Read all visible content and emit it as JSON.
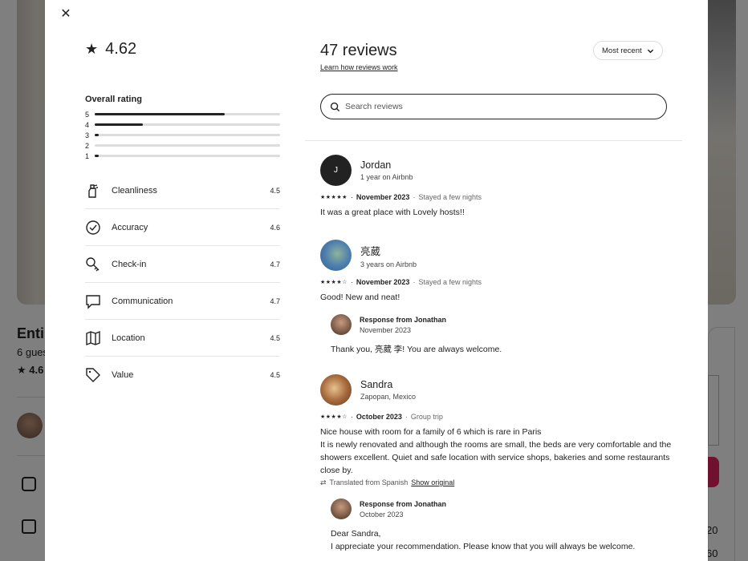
{
  "background": {
    "title": "Enti",
    "guests": "6 gues",
    "rating": "★ 4.6",
    "num1": "20",
    "num2": "60"
  },
  "modal": {
    "close_glyph": "✕",
    "overall_rating": "4.62",
    "overall_label": "Overall rating",
    "rating_bars": [
      {
        "stars": "5",
        "fraction": 0.7
      },
      {
        "stars": "4",
        "fraction": 0.26
      },
      {
        "stars": "3",
        "fraction": 0.02
      },
      {
        "stars": "2",
        "fraction": 0.0
      },
      {
        "stars": "1",
        "fraction": 0.02
      }
    ],
    "categories": [
      {
        "name": "Cleanliness",
        "value": "4.5",
        "icon": "spray-bottle-icon"
      },
      {
        "name": "Accuracy",
        "value": "4.6",
        "icon": "check-circle-icon"
      },
      {
        "name": "Check-in",
        "value": "4.7",
        "icon": "key-icon"
      },
      {
        "name": "Communication",
        "value": "4.7",
        "icon": "message-bubble-icon"
      },
      {
        "name": "Location",
        "value": "4.5",
        "icon": "map-icon"
      },
      {
        "name": "Value",
        "value": "4.5",
        "icon": "tag-icon"
      }
    ],
    "reviews_count": "47 reviews",
    "learn_link": "Learn how reviews work",
    "sort_label": "Most recent",
    "search_placeholder": "Search reviews",
    "reviews": [
      {
        "name": "Jordan",
        "initial": "J",
        "subtitle": "1 year on Airbnb",
        "stars": "★★★★★",
        "date": "November 2023",
        "stay": "Stayed a few nights",
        "text": "It was a great place with Lovely hosts!!"
      },
      {
        "name": "亮葳",
        "subtitle": "3 years on Airbnb",
        "stars": "★★★★☆",
        "date": "November 2023",
        "stay": "Stayed a few nights",
        "text": "Good! New and neat!",
        "response": {
          "label": "Response from Jonathan",
          "date": "November 2023",
          "text": "Thank you, 亮葳 李! You are always welcome."
        }
      },
      {
        "name": "Sandra",
        "subtitle": "Zapopan, Mexico",
        "stars": "★★★★☆",
        "date": "October 2023",
        "stay": "Group trip",
        "text_lines": [
          "Nice house with room for a family of 6 which is rare in Paris",
          "It is newly renovated and although the rooms are small, the beds are very comfortable and the showers excellent. Quiet and safe location with service shops, bakeries and some restaurants close by."
        ],
        "translated": "Translated from Spanish",
        "show_original": "Show original",
        "response": {
          "label": "Response from Jonathan",
          "date": "October 2023",
          "text_lines": [
            "Dear Sandra,",
            "I appreciate your recommendation. Please know that you will always be welcome."
          ]
        }
      }
    ]
  }
}
